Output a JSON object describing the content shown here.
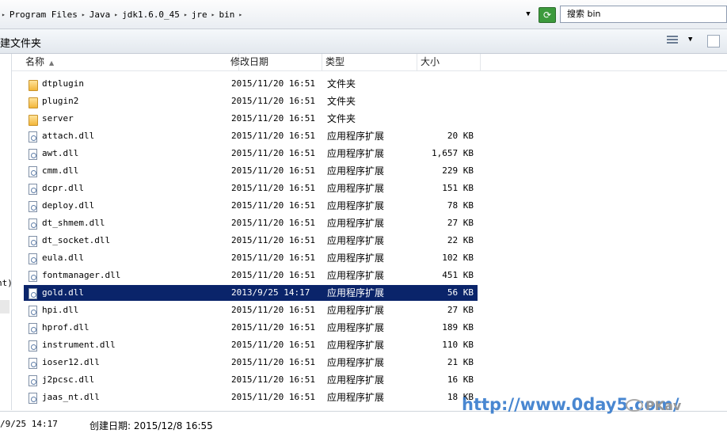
{
  "address": {
    "crumbs": [
      "Program Files",
      "Java",
      "jdk1.6.0_45",
      "jre",
      "bin"
    ],
    "search_label": "搜索 bin"
  },
  "toolbar": {
    "new_folder": "建文件夹"
  },
  "nav": {
    "partial_text": "nt)"
  },
  "columns": {
    "name": "名称",
    "modified": "修改日期",
    "type": "类型",
    "size": "大小"
  },
  "files": [
    {
      "name": "dtplugin",
      "date": "2015/11/20 16:51",
      "type": "文件夹",
      "size": "",
      "kind": "folder",
      "selected": false
    },
    {
      "name": "plugin2",
      "date": "2015/11/20 16:51",
      "type": "文件夹",
      "size": "",
      "kind": "folder",
      "selected": false
    },
    {
      "name": "server",
      "date": "2015/11/20 16:51",
      "type": "文件夹",
      "size": "",
      "kind": "folder",
      "selected": false
    },
    {
      "name": "attach.dll",
      "date": "2015/11/20 16:51",
      "type": "应用程序扩展",
      "size": "20 KB",
      "kind": "dll",
      "selected": false
    },
    {
      "name": "awt.dll",
      "date": "2015/11/20 16:51",
      "type": "应用程序扩展",
      "size": "1,657 KB",
      "kind": "dll",
      "selected": false
    },
    {
      "name": "cmm.dll",
      "date": "2015/11/20 16:51",
      "type": "应用程序扩展",
      "size": "229 KB",
      "kind": "dll",
      "selected": false
    },
    {
      "name": "dcpr.dll",
      "date": "2015/11/20 16:51",
      "type": "应用程序扩展",
      "size": "151 KB",
      "kind": "dll",
      "selected": false
    },
    {
      "name": "deploy.dll",
      "date": "2015/11/20 16:51",
      "type": "应用程序扩展",
      "size": "78 KB",
      "kind": "dll",
      "selected": false
    },
    {
      "name": "dt_shmem.dll",
      "date": "2015/11/20 16:51",
      "type": "应用程序扩展",
      "size": "27 KB",
      "kind": "dll",
      "selected": false
    },
    {
      "name": "dt_socket.dll",
      "date": "2015/11/20 16:51",
      "type": "应用程序扩展",
      "size": "22 KB",
      "kind": "dll",
      "selected": false
    },
    {
      "name": "eula.dll",
      "date": "2015/11/20 16:51",
      "type": "应用程序扩展",
      "size": "102 KB",
      "kind": "dll",
      "selected": false
    },
    {
      "name": "fontmanager.dll",
      "date": "2015/11/20 16:51",
      "type": "应用程序扩展",
      "size": "451 KB",
      "kind": "dll",
      "selected": false
    },
    {
      "name": "gold.dll",
      "date": "2013/9/25 14:17",
      "type": "应用程序扩展",
      "size": "56 KB",
      "kind": "dll",
      "selected": true
    },
    {
      "name": "hpi.dll",
      "date": "2015/11/20 16:51",
      "type": "应用程序扩展",
      "size": "27 KB",
      "kind": "dll",
      "selected": false
    },
    {
      "name": "hprof.dll",
      "date": "2015/11/20 16:51",
      "type": "应用程序扩展",
      "size": "189 KB",
      "kind": "dll",
      "selected": false
    },
    {
      "name": "instrument.dll",
      "date": "2015/11/20 16:51",
      "type": "应用程序扩展",
      "size": "110 KB",
      "kind": "dll",
      "selected": false
    },
    {
      "name": "ioser12.dll",
      "date": "2015/11/20 16:51",
      "type": "应用程序扩展",
      "size": "21 KB",
      "kind": "dll",
      "selected": false
    },
    {
      "name": "j2pcsc.dll",
      "date": "2015/11/20 16:51",
      "type": "应用程序扩展",
      "size": "16 KB",
      "kind": "dll",
      "selected": false
    },
    {
      "name": "jaas_nt.dll",
      "date": "2015/11/20 16:51",
      "type": "应用程序扩展",
      "size": "18 KB",
      "kind": "dll",
      "selected": false
    }
  ],
  "status": {
    "modified": "/9/25 14:17",
    "created": "创建日期: 2015/12/8 16:55"
  },
  "watermark": {
    "url": "http://www.0day5.com/",
    "brand": "PKav",
    "color": "#2a73c9"
  },
  "colors": {
    "selection": "#0a246a"
  }
}
